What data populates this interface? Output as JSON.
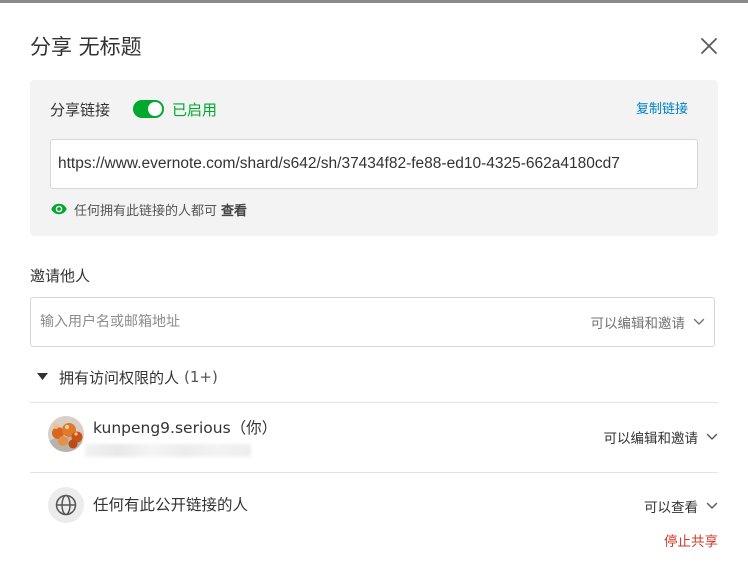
{
  "dialog": {
    "title": "分享 无标题",
    "close_icon": "close-icon"
  },
  "share_link": {
    "label": "分享链接",
    "toggle_on": true,
    "status": "已启用",
    "copy_label": "复制链接",
    "url": "https://www.evernote.com/shard/s642/sh/37434f82-fe88-ed10-4325-662a4180cd7",
    "view_note_prefix": "任何拥有此链接的人都可",
    "view_note_strong": "查看",
    "view_icon": "eye-icon"
  },
  "invite": {
    "title": "邀请他人",
    "placeholder": "输入用户名或邮箱地址",
    "permission": "可以编辑和邀请"
  },
  "access": {
    "header": "拥有访问权限的人",
    "count": "(1+)",
    "people": [
      {
        "name": "kunpeng9.serious（你）",
        "permission": "可以编辑和邀请",
        "email_redacted": true
      }
    ],
    "public": {
      "label": "任何有此公开链接的人",
      "permission": "可以查看",
      "stop_label": "停止共享",
      "icon": "globe-icon"
    }
  },
  "colors": {
    "accent_green": "#00a82d",
    "link_blue": "#0081c2",
    "danger_red": "#d0392b",
    "panel_gray": "#f3f3f3"
  }
}
